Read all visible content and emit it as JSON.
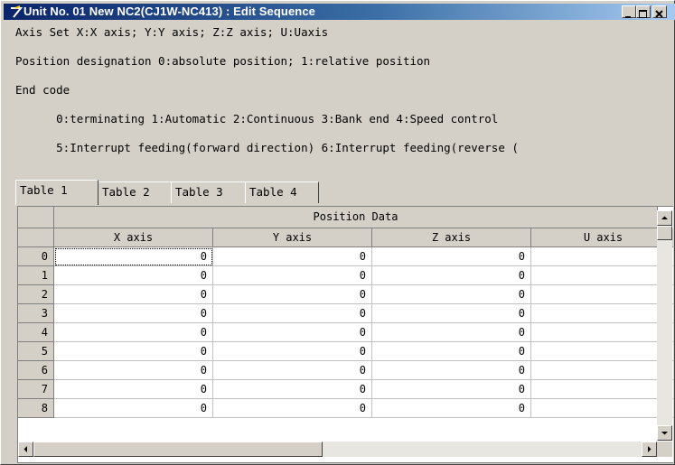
{
  "window": {
    "title": "Unit No. 01 New NC2(CJ1W-NC413) : Edit Sequence"
  },
  "info_lines": [
    "Axis Set X:X axis; Y:Y axis; Z:Z axis; U:Uaxis",
    "Position designation 0:absolute position; 1:relative position",
    "End code",
    "      0:terminating 1:Automatic 2:Continuous 3:Bank end 4:Speed control",
    "      5:Interrupt feeding(forward direction) 6:Interrupt feeding(reverse ("
  ],
  "tabs": [
    "Table 1",
    "Table 2",
    "Table 3",
    "Table 4"
  ],
  "active_tab": "Table 1",
  "grid": {
    "group_header": "Position Data",
    "columns": [
      "X axis",
      "Y axis",
      "Z axis",
      "U axis"
    ],
    "rows": [
      {
        "index": "0",
        "values": [
          "0",
          "0",
          "0",
          ""
        ]
      },
      {
        "index": "1",
        "values": [
          "0",
          "0",
          "0",
          ""
        ]
      },
      {
        "index": "2",
        "values": [
          "0",
          "0",
          "0",
          ""
        ]
      },
      {
        "index": "3",
        "values": [
          "0",
          "0",
          "0",
          ""
        ]
      },
      {
        "index": "4",
        "values": [
          "0",
          "0",
          "0",
          ""
        ]
      },
      {
        "index": "5",
        "values": [
          "0",
          "0",
          "0",
          ""
        ]
      },
      {
        "index": "6",
        "values": [
          "0",
          "0",
          "0",
          ""
        ]
      },
      {
        "index": "7",
        "values": [
          "0",
          "0",
          "0",
          ""
        ]
      },
      {
        "index": "8",
        "values": [
          "0",
          "0",
          "0",
          ""
        ]
      }
    ]
  },
  "colors": {
    "title_start": "#0a246a",
    "title_end": "#a6caf0",
    "face": "#d4d0c8"
  }
}
